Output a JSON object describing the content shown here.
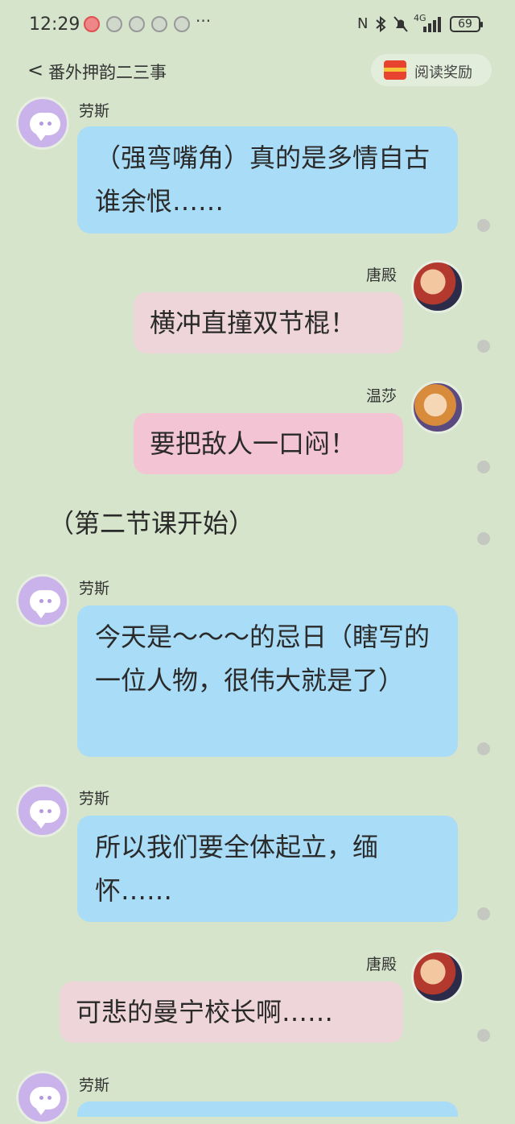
{
  "status_bar": {
    "time": "12:29",
    "more": "···",
    "network": "4G",
    "battery": "69"
  },
  "header": {
    "title": "番外押韵二三事",
    "reward_label": "阅读奖励"
  },
  "messages": [
    {
      "speaker": "劳斯",
      "text": "（强弯嘴角）真的是多情自古谁余恨……"
    },
    {
      "speaker": "唐殿",
      "text": "横冲直撞双节棍！"
    },
    {
      "speaker": "温莎",
      "text": "要把敌人一口闷！"
    },
    {
      "narration": "（第二节课开始）"
    },
    {
      "speaker": "劳斯",
      "text": "今天是～～～的忌日（瞎写的一位人物，很伟大就是了）"
    },
    {
      "speaker": "劳斯",
      "text": "所以我们要全体起立，缅怀……"
    },
    {
      "speaker": "唐殿",
      "text": "可悲的曼宁校长啊……"
    },
    {
      "speaker": "劳斯",
      "text": ""
    }
  ],
  "colors": {
    "background": "#d5e4cb",
    "bubble_left": "#a9dcf6",
    "bubble_right": "#f3c5d4",
    "avatar_purple": "#c9b3ea"
  }
}
